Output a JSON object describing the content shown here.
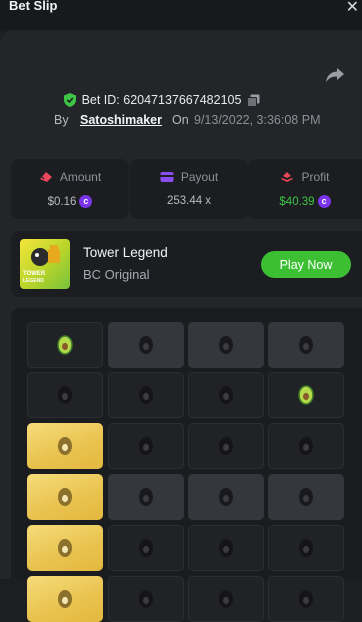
{
  "header": {
    "title": "Bet Slip",
    "close_icon": "close-icon"
  },
  "bet": {
    "id_label": "Bet ID: 62047137667482105",
    "by_label": "By",
    "username": "Satoshimaker",
    "on_label": "On",
    "datetime": "9/13/2022, 3:36:08 PM"
  },
  "stats": {
    "amount": {
      "label": "Amount",
      "value": "$0.16"
    },
    "payout": {
      "label": "Payout",
      "value": "253.44 x"
    },
    "profit": {
      "label": "Profit",
      "value": "$40.39"
    }
  },
  "game": {
    "name": "Tower Legend",
    "subtitle": "BC Original",
    "play_label": "Play Now",
    "thumb_text_1": "TOWER",
    "thumb_text_2": "LEGEND"
  },
  "colors": {
    "accent_green": "#3cbf33",
    "profit_green": "#3fc445",
    "coin_purple": "#7b35e8",
    "gold_tile": "#e9c24e"
  },
  "board": {
    "rows": [
      [
        "avocado-dark",
        "light",
        "light",
        "light"
      ],
      [
        "dark",
        "dark",
        "dark",
        "avocado-dark"
      ],
      [
        "gold",
        "dark",
        "dark",
        "dark"
      ],
      [
        "gold",
        "light",
        "light",
        "light"
      ],
      [
        "gold",
        "dark",
        "dark",
        "dark"
      ],
      [
        "gold",
        "dark",
        "dark",
        "dark"
      ]
    ]
  }
}
